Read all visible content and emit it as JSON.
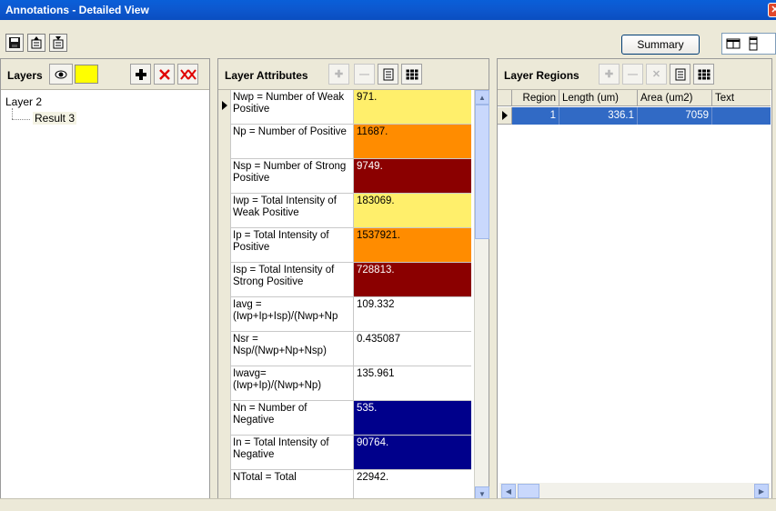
{
  "window": {
    "title": "Annotations - Detailed View"
  },
  "toolbar": {
    "icons": [
      "save-icon",
      "export-icon",
      "import-icon"
    ],
    "summary_label": "Summary"
  },
  "layers": {
    "title": "Layers",
    "color": "#ffff00",
    "tree": [
      {
        "label": "Layer 2",
        "children": [
          {
            "label": "Result 3"
          }
        ]
      }
    ]
  },
  "attributes": {
    "title": "Layer Attributes",
    "rows": [
      {
        "name": "Nwp = Number of Weak Positive",
        "value": "971.",
        "color": "#ffef6b"
      },
      {
        "name": "Np  = Number of Positive",
        "value": "11687.",
        "color": "#ff8c00"
      },
      {
        "name": "Nsp = Number of Strong Positive",
        "value": "9749.",
        "color": "#8b0000"
      },
      {
        "name": "Iwp = Total Intensity of Weak Positive",
        "value": "183069.",
        "color": "#ffef6b"
      },
      {
        "name": "Ip  = Total Intensity of Positive",
        "value": "1537921.",
        "color": "#ff8c00"
      },
      {
        "name": "Isp = Total Intensity of Strong Positive",
        "value": "728813.",
        "color": "#8b0000"
      },
      {
        "name": "Iavg = (Iwp+Ip+Isp)/(Nwp+Np",
        "value": "109.332",
        "color": "#ffffff"
      },
      {
        "name": "Nsr = Nsp/(Nwp+Np+Nsp)",
        "value": "0.435087",
        "color": "#ffffff"
      },
      {
        "name": "Iwavg= (Iwp+Ip)/(Nwp+Np)",
        "value": "135.961",
        "color": "#ffffff"
      },
      {
        "name": "Nn = Number of Negative",
        "value": "535.",
        "color": "#00008b"
      },
      {
        "name": "In = Total Intensity of Negative",
        "value": "90764.",
        "color": "#00008b"
      },
      {
        "name": "NTotal = Total",
        "value": "22942.",
        "color": "#ffffff"
      }
    ]
  },
  "regions": {
    "title": "Layer Regions",
    "columns": [
      "Region",
      "Length (um)",
      "Area (um2)",
      "Text"
    ],
    "rows": [
      {
        "region": "1",
        "length": "336.1",
        "area": "7059",
        "text": ""
      }
    ]
  }
}
